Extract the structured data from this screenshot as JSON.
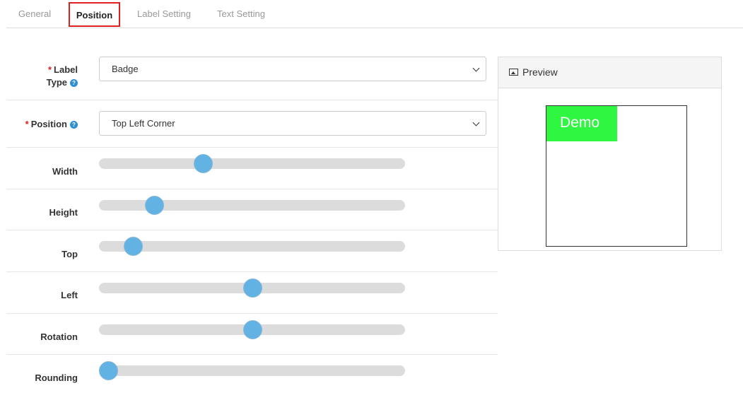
{
  "tabs": [
    {
      "label": "General"
    },
    {
      "label": "Position",
      "active": true
    },
    {
      "label": "Label Setting"
    },
    {
      "label": "Text Setting"
    }
  ],
  "form": {
    "required_mark": "*",
    "help_glyph": "?",
    "label_type": {
      "label_line1": "Label",
      "label_line2": "Type",
      "value": "Badge"
    },
    "position": {
      "label": "Position",
      "value": "Top Left Corner"
    },
    "sliders": [
      {
        "label": "Width",
        "level_percent": 34
      },
      {
        "label": "Height",
        "level_percent": 18
      },
      {
        "label": "Top",
        "level_percent": 11
      },
      {
        "label": "Left",
        "level_percent": 50
      },
      {
        "label": "Rotation",
        "level_percent": 50
      },
      {
        "label": "Rounding",
        "level_percent": 3
      }
    ]
  },
  "preview": {
    "title": "Preview",
    "badge_text": "Demo",
    "badge_color": "#2ff640"
  },
  "colors": {
    "accent_slider": "#62b3e3",
    "active_tab_border": "#e0201e",
    "required": "#d9231d"
  }
}
